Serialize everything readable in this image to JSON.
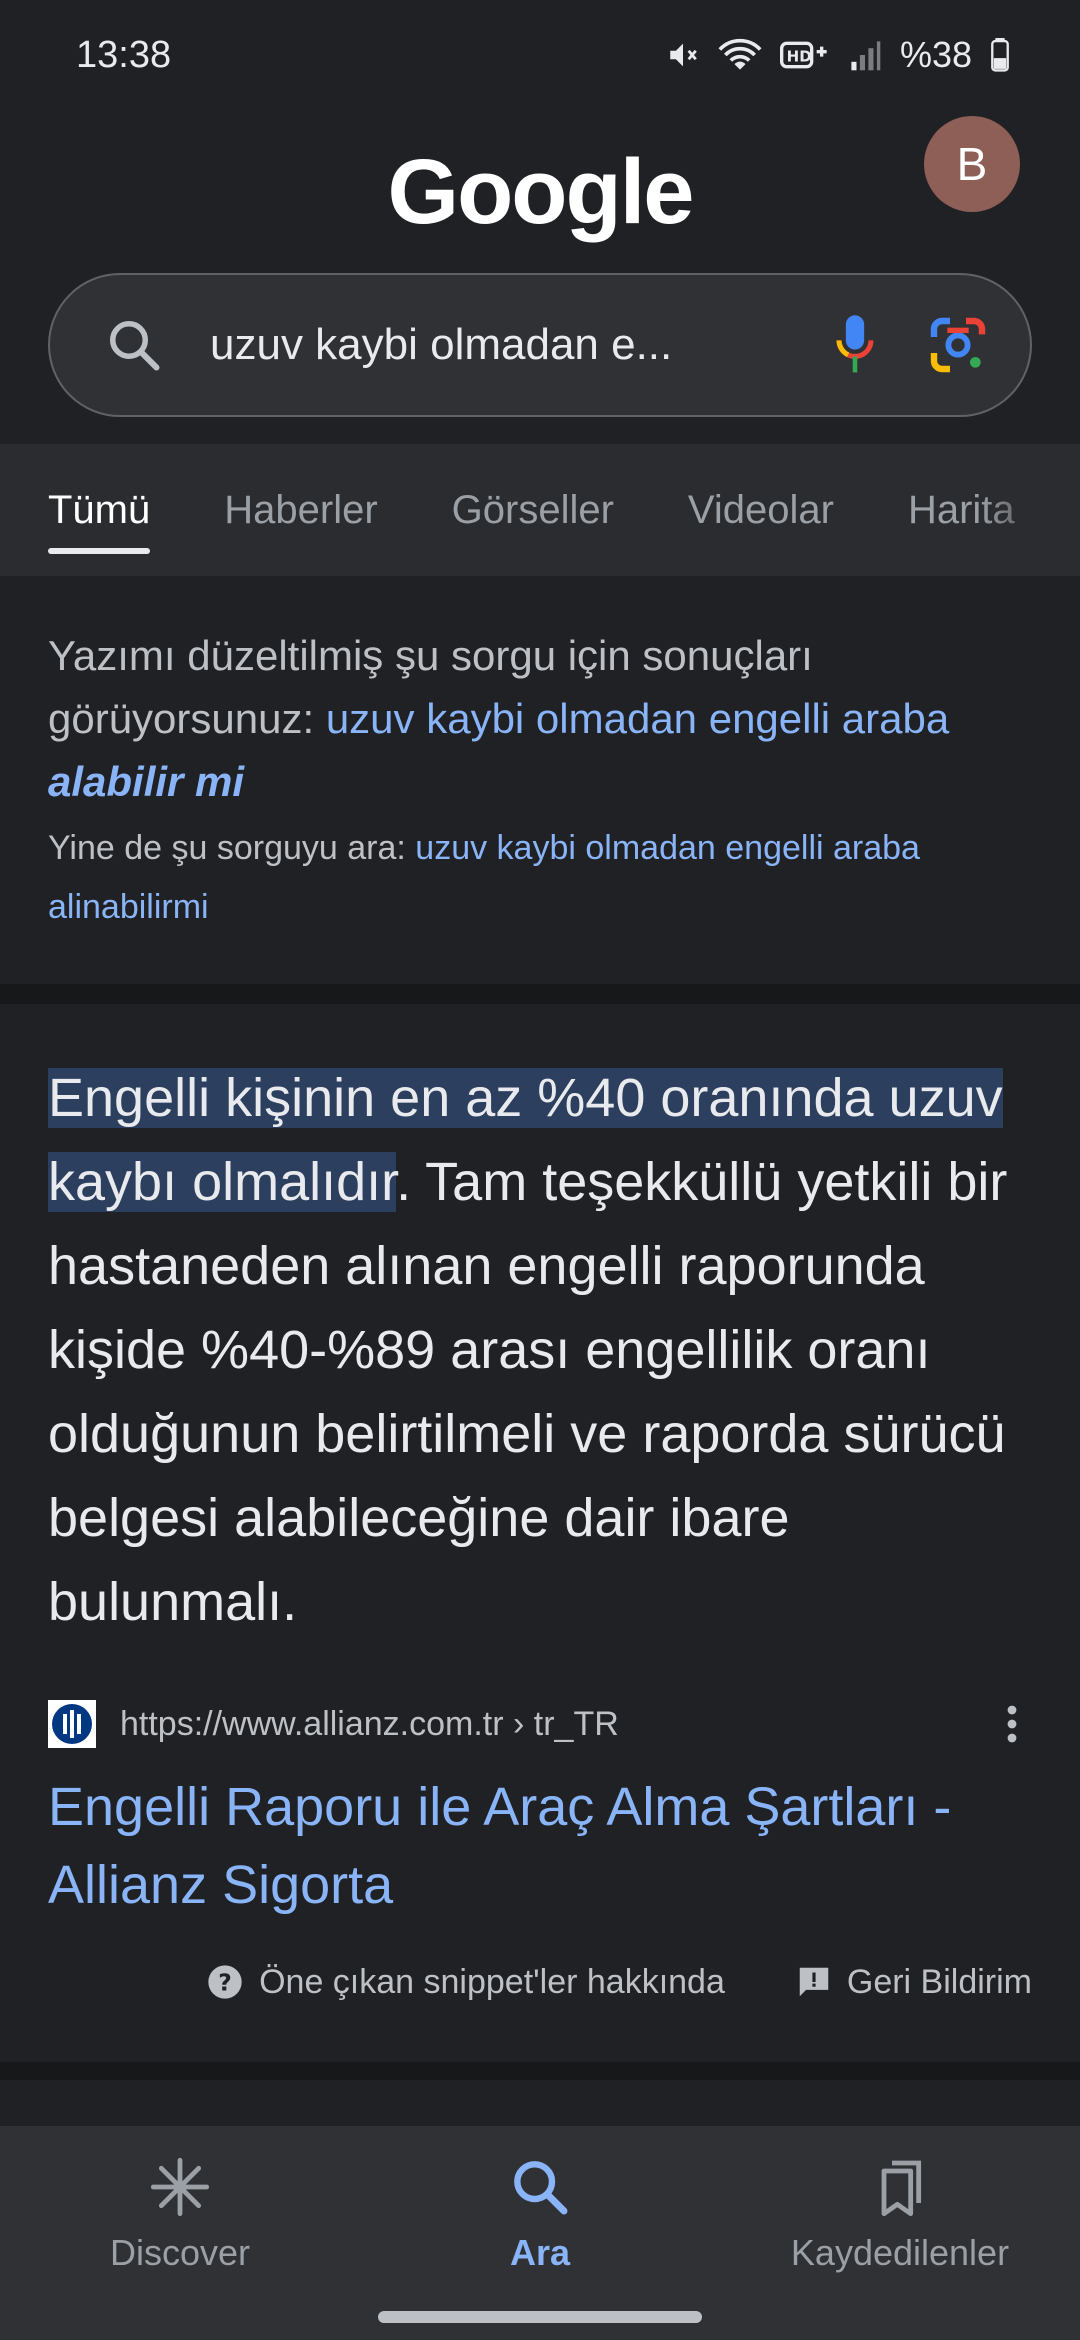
{
  "status_bar": {
    "time": "13:38",
    "battery": "%38",
    "icons": [
      "mute-icon",
      "wifi-icon",
      "hd-voice-icon",
      "signal-icon",
      "battery-icon"
    ]
  },
  "header": {
    "logo": "Google",
    "avatar_initial": "B"
  },
  "search": {
    "query": "uzuv kaybi olmadan e..."
  },
  "tabs": [
    {
      "label": "Tümü",
      "active": true
    },
    {
      "label": "Haberler"
    },
    {
      "label": "Görseller"
    },
    {
      "label": "Videolar"
    },
    {
      "label": "Harita"
    }
  ],
  "spelling": {
    "prefix": "Yazımı düzeltilmiş şu sorgu için sonuçları görüyorsunuz: ",
    "corrected_plain": "uzuv kaybi olmadan engelli araba ",
    "corrected_bold": "alabilir mi",
    "search_instead_prefix": "Yine de şu sorguyu ara: ",
    "original_query": "uzuv kaybi olmadan engelli araba alinabilirmi"
  },
  "snippet": {
    "highlight": "Engelli kişinin en az %40 oranında uzuv kaybı olmalıdır",
    "rest": ". Tam teşekküllü yetkili bir hastaneden alınan engelli raporunda kişide %40-%89 arası engellilik oranı olduğunun belirtilmeli ve raporda sürücü belgesi alabileceğine dair ibare bulunmalı.",
    "source_url": "https://www.allianz.com.tr › tr_TR",
    "title": "Engelli Raporu ile Araç Alma Şartları - Allianz Sigorta",
    "about_label": "Öne çıkan snippet'ler hakkında",
    "feedback_label": "Geri Bildirim"
  },
  "bottom_nav": [
    {
      "label": "Discover",
      "icon": "discover-icon"
    },
    {
      "label": "Ara",
      "icon": "search-icon",
      "active": true
    },
    {
      "label": "Kaydedilenler",
      "icon": "saved-icon"
    }
  ],
  "colors": {
    "background": "#202124",
    "link": "#8ab4f8",
    "highlight": "#2d3f5e",
    "avatar": "#8d5f57"
  }
}
